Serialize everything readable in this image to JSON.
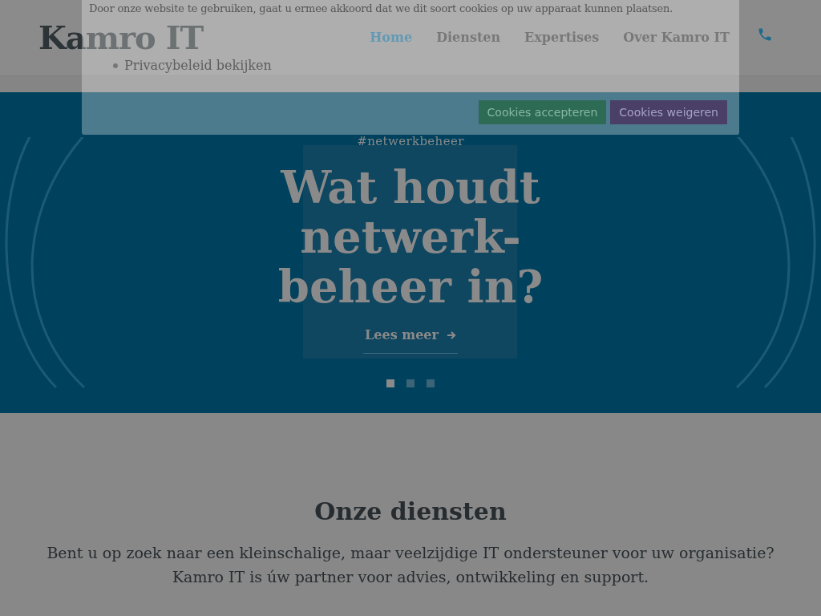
{
  "header": {
    "logo": "Kamro IT",
    "nav": [
      {
        "label": "Home",
        "selected": true
      },
      {
        "label": "Diensten",
        "selected": false
      },
      {
        "label": "Expertises",
        "selected": false
      },
      {
        "label": "Over Kamro IT",
        "selected": false
      }
    ]
  },
  "hero": {
    "tag": "#netwerkbeheer",
    "title": "Wat houdt netwerk-beheer in?",
    "cta": "Lees meer",
    "slides": [
      {
        "selected": true
      },
      {
        "selected": false
      },
      {
        "selected": false
      }
    ]
  },
  "services": {
    "heading": "Onze diensten",
    "intro": "Bent u op zoek naar een kleinschalige, maar veelzijdige IT ondersteuner voor uw organisatie? Kamro IT is úw partner voor advies, ontwikkeling en support."
  },
  "cookie_banner": {
    "message": "Door onze website te gebruiken, gaat u ermee akkoord dat we dit soort cookies op uw apparaat kunnen plaatsen.",
    "links": [
      "Privacybeleid bekijken"
    ],
    "buttons": [
      {
        "label": "Cookies accepteren",
        "kind": "accept"
      },
      {
        "label": "Cookies weigeren",
        "kind": "decline"
      }
    ]
  }
}
